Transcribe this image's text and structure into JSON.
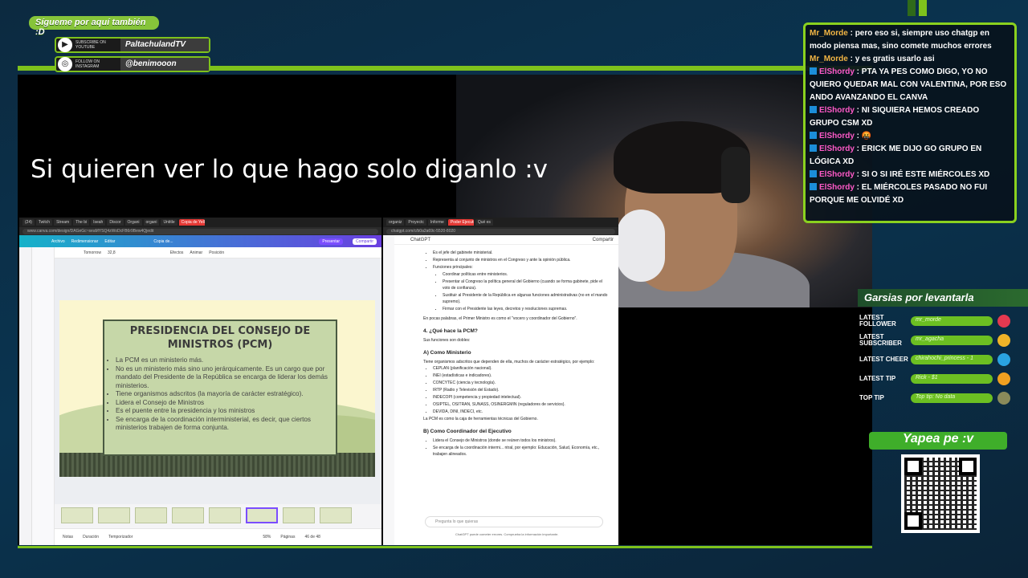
{
  "social": {
    "header": "Sígueme por aquí también :D",
    "youtube_label": "SUBSCRIBE ON YOUTUBE",
    "youtube_name": "PaltachulandTV",
    "instagram_label": "FOLLOW ON INSTAGRAM",
    "instagram_name": "@benimooon"
  },
  "overlay_text": "Si quieren ver lo que hago solo diganlo :v",
  "left_browser": {
    "tabs": [
      "(24)",
      "Twitch",
      "Stream",
      "The bi",
      "Iseah",
      "Discor",
      "Organi",
      "organi",
      "Untitle",
      "Copia de Yello"
    ],
    "active_tab": "Copia de Yello",
    "url": "www.canva.com/design/DAGeGc~seaMYSQ4zWoDcFB6r9Bew4Qjedit",
    "canva_menu": [
      "Archivo",
      "Redimensionar",
      "Editar"
    ],
    "doc_name": "Copia de...",
    "present": "Presentar",
    "share": "Compartir",
    "toolbar": [
      "Tomorrow",
      "32,8",
      "Efectos",
      "Animar",
      "Posición"
    ],
    "slide_title": "PRESIDENCIA DEL CONSEJO DE MINISTROS (PCM)",
    "slide_bullets": [
      "La PCM es un ministerio más.",
      "No es un ministerio más sino uno jerárquicamente. Es un cargo que por mandato del Presidente de la República se encarga de liderar los demás ministerios.",
      "Tiene organismos adscritos (la mayoría de carácter estratégico).",
      "Lidera el Consejo de Ministros",
      "Es el puente entre la presidencia y los ministros",
      "Se encarga de la coordinación interministerial, es decir, que ciertos ministerios trabajen de forma conjunta."
    ],
    "bottom": [
      "Notas",
      "Duración",
      "Temporizador",
      "58%",
      "Páginas",
      "46 de 48"
    ]
  },
  "right_browser": {
    "tabs": [
      "organiz",
      "Proyectc",
      "Informe",
      "Poder Ejecutivo",
      "Qué es"
    ],
    "active_tab": "Poder Ejecutivo",
    "url": "chatgpt.com/c/b0a2a69c-5520-8020",
    "app_title": "ChatGPT",
    "share": "Compartir",
    "intro_bullets": [
      "Es el jefe del gabinete ministerial.",
      "Representa al conjunto de ministros en el Congreso y ante la opinión pública.",
      "Funciones principales:"
    ],
    "sub_bullets": [
      "Coordinar políticas entre ministerios.",
      "Presentar al Congreso la política general del Gobierno (cuando se forma gabinete, pide el voto de confianza).",
      "Sustituir al Presidente de la República en algunas funciones administrativas (no en el mando supremo).",
      "Firmar con el Presidente las leyes, decretos y resoluciones supremas."
    ],
    "summary": "En pocas palabras, el Primer Ministro es como el \"vocero y coordinador del Gobierno\".",
    "section_title": "4. ¿Qué hace la PCM?",
    "section_intro": "Sus funciones son dobles:",
    "sub_a": "A) Como Ministerio",
    "sub_a_intro": "Tiene organismos adscritos que dependen de ella, muchos de carácter estratégico, por ejemplo:",
    "organisms": [
      "CEPLAN (planificación nacional).",
      "INEI (estadísticas e indicadores).",
      "CONCYTEC (ciencia y tecnología).",
      "IRTP (Radio y Televisión del Estado).",
      "INDECOPI (competencia y propiedad intelectual).",
      "OSIPTEL, OSITRAN, SUNASS, OSINERGMIN (reguladores de servicios).",
      "DEVIDA, DINI, INDECI, etc."
    ],
    "organisms_note": "La PCM es como la caja de herramientas técnicas del Gobierno.",
    "sub_b": "B) Como Coordinador del Ejecutivo",
    "coord_bullets": [
      "Lidera el Consejo de Ministros (donde se reúnen todos los ministros).",
      "Se encarga de la coordinación intermi... ntral, por ejemplo: Educación, Salud, Economía, etc., trabajen alineados."
    ],
    "input_placeholder": "Pregunta lo que quieras",
    "disclaimer": "ChatGPT puede cometer errores. Comprueba la información importante."
  },
  "chat": [
    {
      "user": "Mr_Morde",
      "badge": false,
      "color": "#f2b544",
      "text": "pero eso si, siempre uso chatgp en modo piensa mas, sino comete muchos errores"
    },
    {
      "user": "Mr_Morde",
      "badge": false,
      "color": "#f2b544",
      "text": "y es gratis usarlo asi"
    },
    {
      "user": "ElShordy",
      "badge": true,
      "color": "#ff5ac8",
      "text": "PTA YA PES COMO DIGO, YO NO QUIERO QUEDAR MAL CON VALENTINA, POR ESO ANDO AVANZANDO EL CANVA"
    },
    {
      "user": "ElShordy",
      "badge": true,
      "color": "#ff5ac8",
      "text": "NI SIQUIERA HEMOS CREADO GRUPO CSM XD"
    },
    {
      "user": "ElShordy",
      "badge": true,
      "color": "#ff5ac8",
      "text": "🤬"
    },
    {
      "user": "ElShordy",
      "badge": true,
      "color": "#ff5ac8",
      "text": "ERICK ME DIJO GO GRUPO EN LÓGICA XD"
    },
    {
      "user": "ElShordy",
      "badge": true,
      "color": "#ff5ac8",
      "text": "SI O SI IRÉ ESTE MIÉRCOLES XD"
    },
    {
      "user": "ElShordy",
      "badge": true,
      "color": "#ff5ac8",
      "text": "EL MIÉRCOLES PASADO NO FUI PORQUE ME OLVIDÉ XD"
    }
  ],
  "stats": {
    "title": "Garsias por levantarla",
    "rows": [
      {
        "label": "LATEST FOLLOWER",
        "value": "mr_morde",
        "icon": "heart-icon",
        "color": "#e53950"
      },
      {
        "label": "LATEST SUBSCRIBER",
        "value": "mr_agacha",
        "icon": "star-icon",
        "color": "#f0b428"
      },
      {
        "label": "LATEST CHEER",
        "value": "chirahochi_princess - 1",
        "icon": "gem-icon",
        "color": "#2aa3e0"
      },
      {
        "label": "LATEST TIP",
        "value": "Rick - $1",
        "icon": "coin-icon",
        "color": "#f0a020"
      },
      {
        "label": "TOP TIP",
        "value": "Top tip: No data",
        "icon": "moneybag-icon",
        "color": "#8a8a5a"
      }
    ]
  },
  "yapea": "Yapea pe :v"
}
